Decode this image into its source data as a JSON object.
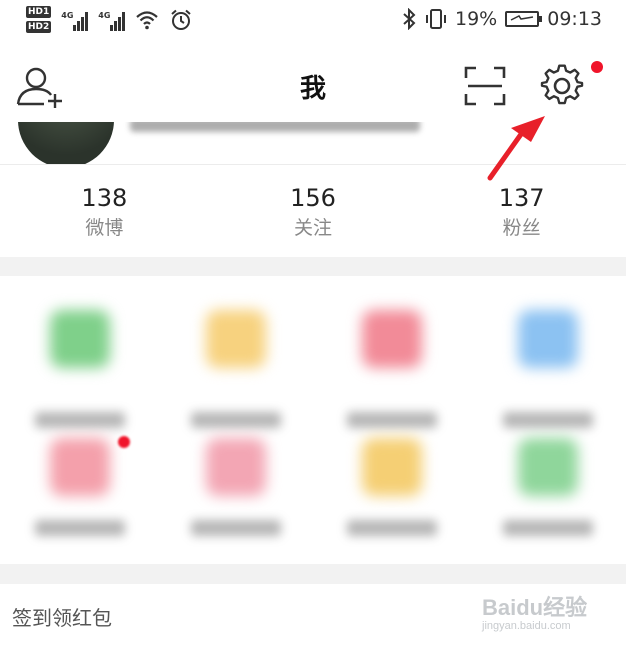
{
  "status_bar": {
    "hd_labels": [
      "HD1",
      "HD2"
    ],
    "network_labels": [
      "4G",
      "4G"
    ],
    "battery_percent": "19%",
    "time": "09:13",
    "icons": [
      "signal-icon",
      "wifi-icon",
      "alarm-icon",
      "bluetooth-icon",
      "vibrate-icon",
      "battery-icon"
    ]
  },
  "header": {
    "title": "我",
    "left_icon": "add-user-icon",
    "right_icons": [
      "scan-icon",
      "settings-icon"
    ],
    "settings_badge_color": "#f0142a"
  },
  "stats": [
    {
      "value": "138",
      "label": "微博"
    },
    {
      "value": "156",
      "label": "关注"
    },
    {
      "value": "137",
      "label": "粉丝"
    }
  ],
  "bottom": {
    "label": "签到领红包"
  },
  "watermark": {
    "line1": "Baidu经验",
    "line2": "jingyan.baidu.com"
  },
  "colors": {
    "annotation_arrow": "#e8202a",
    "divider_band": "#f2f2f2"
  }
}
